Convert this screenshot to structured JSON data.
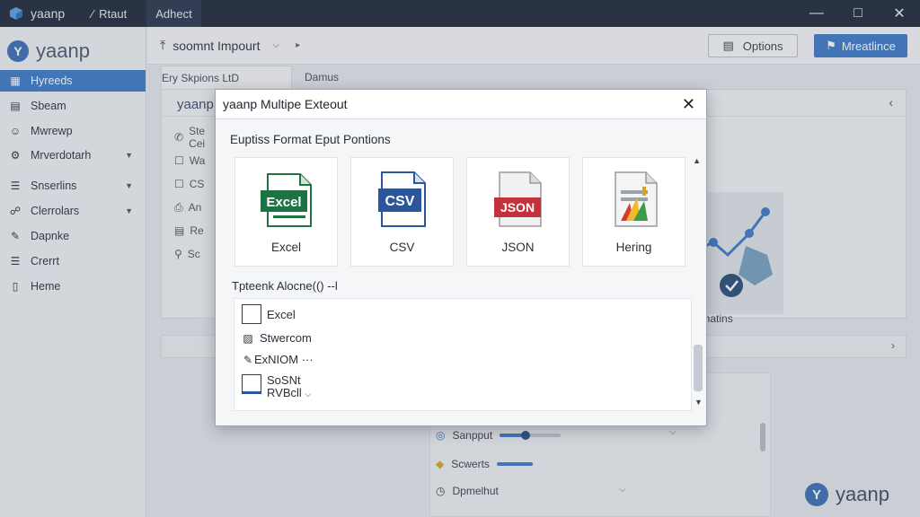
{
  "titlebar": {
    "app_name": "yaanp",
    "menu": [
      {
        "label": "Rtaut",
        "icon": "wand-icon"
      },
      {
        "label": "Adhect"
      }
    ],
    "controls": [
      "minimize",
      "maximize",
      "close"
    ]
  },
  "sidebar": {
    "logo": "yaanp",
    "items": [
      {
        "label": "Hyreeds",
        "icon": "grid-icon",
        "active": true
      },
      {
        "label": "Sbeam",
        "icon": "database-icon"
      },
      {
        "label": "Mwrewp",
        "icon": "people-icon"
      },
      {
        "label": "Mrverdotarh",
        "icon": "gear-icon",
        "chevron": true
      },
      {
        "label": "Snserlins",
        "icon": "list-icon",
        "chevron": true
      },
      {
        "label": "Clerrolars",
        "icon": "network-icon",
        "chevron": true
      },
      {
        "label": "Dapnke",
        "icon": "pen-icon"
      },
      {
        "label": "Crerrt",
        "icon": "list-icon"
      },
      {
        "label": "Heme",
        "icon": "document-icon"
      }
    ]
  },
  "toolbar": {
    "title": "soomnt Impourt",
    "options_label": "Options",
    "primary_label": "Mreatlince"
  },
  "main": {
    "tabs": [
      "Ery Skpions LtD",
      "Damus"
    ],
    "panel_title": "yaanp",
    "rows": [
      "Ste Cei",
      "Wa",
      "CS",
      "An",
      "Re",
      "Sc"
    ],
    "chart_label": "ehatins",
    "settings": [
      {
        "label": "Sanpput",
        "level": 0.4
      },
      {
        "label": "Scwerts",
        "level": 1.0
      },
      {
        "label": "Dpmelhut"
      }
    ]
  },
  "dialog": {
    "title": "yaanp Multipe Exteout",
    "section_title": "Euptiss Format Eput Pontions",
    "formats": [
      {
        "label": "Excel",
        "badge": "Excel",
        "color": "#1f7244"
      },
      {
        "label": "CSV",
        "badge": "CSV",
        "color": "#2b579a"
      },
      {
        "label": "JSON",
        "badge": "JSON",
        "color": "#c6303a"
      },
      {
        "label": "Hering"
      }
    ],
    "sub_title": "Tpteenk Alocne(()  --l",
    "list": [
      {
        "label": "Excel",
        "icon": "checkbox-icon"
      },
      {
        "label": "Stwercom",
        "icon": "image-icon"
      },
      {
        "label": "ExNIOM ···",
        "icon": "pen-icon"
      },
      {
        "label": "SoSNt",
        "label2": "RVBcll",
        "icon": "document-icon"
      }
    ]
  },
  "watermark": "yaanp"
}
